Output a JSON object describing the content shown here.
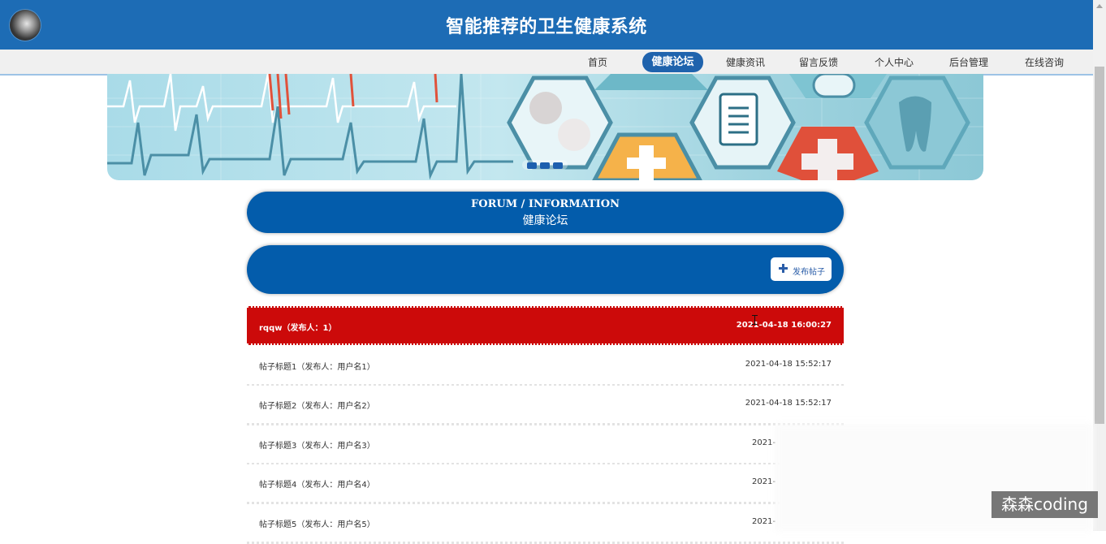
{
  "header": {
    "title": "智能推荐的卫生健康系统"
  },
  "nav": {
    "items": [
      {
        "label": "首页"
      },
      {
        "label": "健康论坛",
        "active": true
      },
      {
        "label": "健康资讯"
      },
      {
        "label": "留言反馈"
      },
      {
        "label": "个人中心"
      },
      {
        "label": "后台管理"
      },
      {
        "label": "在线咨询"
      }
    ]
  },
  "banner": {
    "slides": 3,
    "active_slide": 1
  },
  "section": {
    "title_en": "FORUM / INFORMATION",
    "title_cn": "健康论坛"
  },
  "toolbar": {
    "post_button": "发布帖子"
  },
  "posts": [
    {
      "title": "rqqw（发布人：1）",
      "time": "2021-04-18 16:00:27",
      "highlighted": true
    },
    {
      "title": "帖子标题1（发布人：用户名1）",
      "time": "2021-04-18 15:52:17"
    },
    {
      "title": "帖子标题2（发布人：用户名2）",
      "time": "2021-04-18 15:52:17"
    },
    {
      "title": "帖子标题3（发布人：用户名3）",
      "time": "2021-"
    },
    {
      "title": "帖子标题4（发布人：用户名4）",
      "time": "2021-"
    },
    {
      "title": "帖子标题5（发布人：用户名5）",
      "time": "2021-"
    }
  ],
  "watermark": "森森coding",
  "colors": {
    "primary": "#035cab",
    "header": "#1d6cb5",
    "highlight": "#cc0a0a"
  }
}
